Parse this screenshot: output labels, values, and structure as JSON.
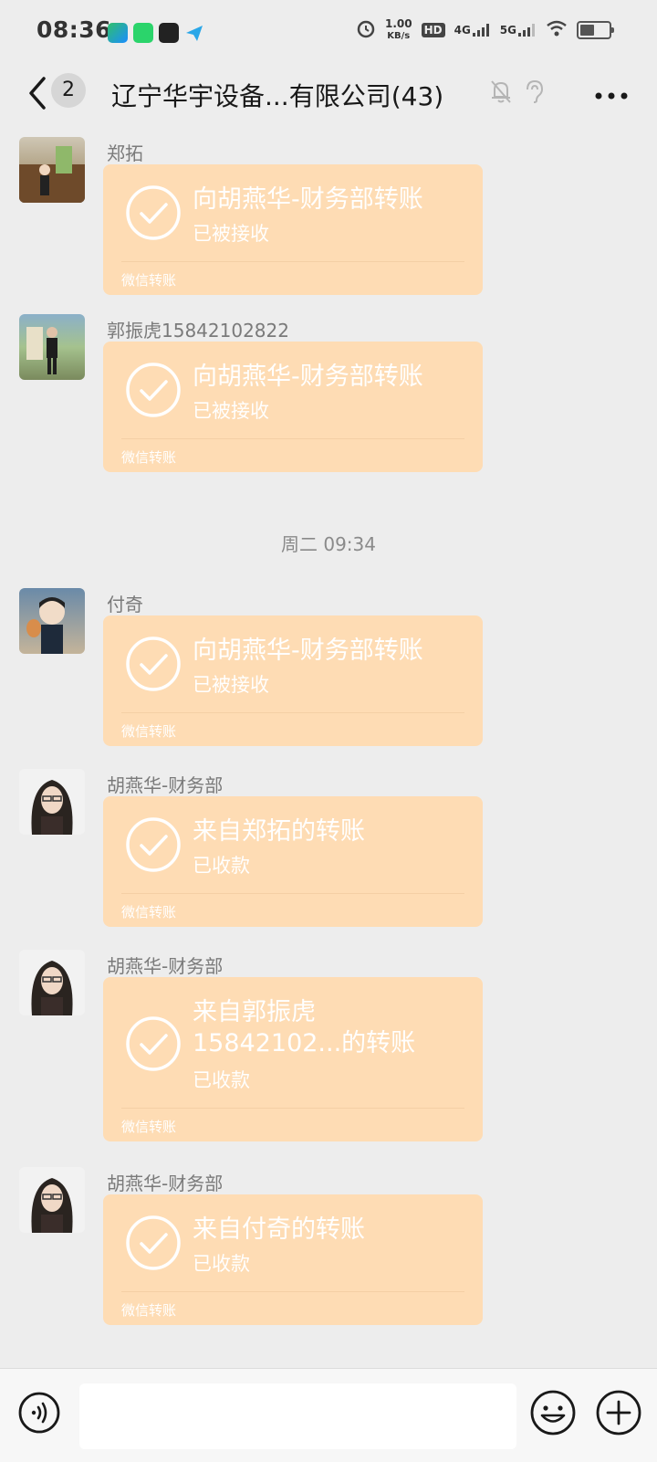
{
  "status_bar": {
    "time": "08:36",
    "speed_value": "1.00",
    "speed_unit": "KB/s",
    "hd_badge": "HD",
    "net_4g": "4G",
    "net_5g": "5G"
  },
  "nav": {
    "unread_count": "2",
    "title": "辽宁华宇设备...有限公司(43)"
  },
  "messages": [
    {
      "sender": "郑拓",
      "title": "向胡燕华-财务部转账",
      "status": "已被接收",
      "footer": "微信转账"
    },
    {
      "sender": "郭振虎15842102822",
      "title": "向胡燕华-财务部转账",
      "status": "已被接收",
      "footer": "微信转账"
    },
    {
      "sender": "付奇",
      "title": "向胡燕华-财务部转账",
      "status": "已被接收",
      "footer": "微信转账"
    },
    {
      "sender": "胡燕华-财务部",
      "title": "来自郑拓的转账",
      "status": "已收款",
      "footer": "微信转账"
    },
    {
      "sender": "胡燕华-财务部",
      "title": "来自郭振虎15842102...的转账",
      "status": "已收款",
      "footer": "微信转账"
    },
    {
      "sender": "胡燕华-财务部",
      "title": "来自付奇的转账",
      "status": "已收款",
      "footer": "微信转账"
    }
  ],
  "time_divider": "周二 09:34",
  "input": {
    "placeholder": ""
  },
  "colors": {
    "background": "#ededed",
    "bubble": "#fedcb4",
    "input_bar": "#f7f7f7"
  }
}
